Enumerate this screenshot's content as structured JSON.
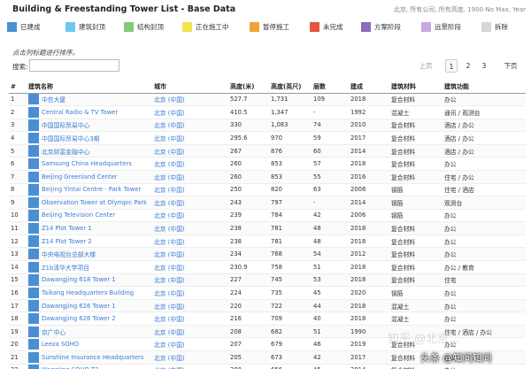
{
  "header": {
    "title": "Building & Freestanding Tower List - Base Data",
    "filters": "北京, 所有公司, 所有高度, 1900-No Max, Year"
  },
  "legend": [
    {
      "label": "已建成",
      "color": "#4a8fd4"
    },
    {
      "label": "建筑封顶",
      "color": "#6ec8f0"
    },
    {
      "label": "结构封顶",
      "color": "#86c97a"
    },
    {
      "label": "正在施工中",
      "color": "#f2e34f"
    },
    {
      "label": "暂停施工",
      "color": "#f2a23a"
    },
    {
      "label": "未完成",
      "color": "#e0573c"
    },
    {
      "label": "方案阶段",
      "color": "#8a6bbf"
    },
    {
      "label": "远景阶段",
      "color": "#c9a9e0"
    },
    {
      "label": "拆除",
      "color": "#d6d6d6"
    }
  ],
  "toolbar": {
    "sort_hint": "点击列标题进行排序。",
    "search_label": "搜索:",
    "search_value": "",
    "search_placeholder": ""
  },
  "pagination": {
    "prev_label": "上页",
    "pages": [
      "1",
      "2",
      "3"
    ],
    "current_page": "1",
    "next_label": "下页"
  },
  "table": {
    "columns": [
      "#",
      "建筑名称",
      "城市",
      "高度(米)",
      "高度(英尺)",
      "层数",
      "建成",
      "建筑材料",
      "建筑功能"
    ],
    "rows": [
      {
        "num": "1",
        "name": "中信大厦",
        "city": "北京 (中国)",
        "height_m": "527.7",
        "height_ft": "1,731",
        "floors": "109",
        "year": "2018",
        "material": "复合材料",
        "function": "办公"
      },
      {
        "num": "2",
        "name": "Central Radio & TV Tower",
        "city": "北京 (中国)",
        "height_m": "410.5",
        "height_ft": "1,347",
        "floors": "-",
        "year": "1992",
        "material": "混凝土",
        "function": "通讯 / 观测台"
      },
      {
        "num": "3",
        "name": "中国国际贸易中心",
        "city": "北京 (中国)",
        "height_m": "330",
        "height_ft": "1,083",
        "floors": "74",
        "year": "2010",
        "material": "复合材料",
        "function": "酒店 / 办公"
      },
      {
        "num": "4",
        "name": "中国国际贸易中心3期",
        "city": "北京 (中国)",
        "height_m": "295.6",
        "height_ft": "970",
        "floors": "59",
        "year": "2017",
        "material": "复合材料",
        "function": "酒店 / 办公"
      },
      {
        "num": "5",
        "name": "北京财富金融中心",
        "city": "北京 (中国)",
        "height_m": "267",
        "height_ft": "876",
        "floors": "60",
        "year": "2014",
        "material": "复合材料",
        "function": "酒店 / 办公"
      },
      {
        "num": "6",
        "name": "Samsung China Headquarters",
        "city": "北京 (中国)",
        "height_m": "260",
        "height_ft": "853",
        "floors": "57",
        "year": "2018",
        "material": "复合材料",
        "function": "办公"
      },
      {
        "num": "7",
        "name": "Beijing Greenland Center",
        "city": "北京 (中国)",
        "height_m": "260",
        "height_ft": "853",
        "floors": "55",
        "year": "2016",
        "material": "复合材料",
        "function": "住宅 / 办公"
      },
      {
        "num": "8",
        "name": "Beijing Yintai Centre - Park Tower",
        "city": "北京 (中国)",
        "height_m": "250",
        "height_ft": "820",
        "floors": "63",
        "year": "2008",
        "material": "钢筋",
        "function": "住宅 / 酒店"
      },
      {
        "num": "9",
        "name": "Observation Tower at Olympic Park",
        "city": "北京 (中国)",
        "height_m": "243",
        "height_ft": "797",
        "floors": "-",
        "year": "2014",
        "material": "钢筋",
        "function": "观测台"
      },
      {
        "num": "10",
        "name": "Beijing Television Center",
        "city": "北京 (中国)",
        "height_m": "239",
        "height_ft": "784",
        "floors": "42",
        "year": "2006",
        "material": "钢筋",
        "function": "办公"
      },
      {
        "num": "11",
        "name": "Z14 Plot Tower 1",
        "city": "北京 (中国)",
        "height_m": "238",
        "height_ft": "781",
        "floors": "48",
        "year": "2018",
        "material": "复合材料",
        "function": "办公"
      },
      {
        "num": "12",
        "name": "Z14 Plot Tower 2",
        "city": "北京 (中国)",
        "height_m": "238",
        "height_ft": "781",
        "floors": "48",
        "year": "2018",
        "material": "复合材料",
        "function": "办公"
      },
      {
        "num": "13",
        "name": "中央电视台总部大楼",
        "city": "北京 (中国)",
        "height_m": "234",
        "height_ft": "768",
        "floors": "54",
        "year": "2012",
        "material": "复合材料",
        "function": "办公"
      },
      {
        "num": "14",
        "name": "Z1b清华大学项目",
        "city": "北京 (中国)",
        "height_m": "230.9",
        "height_ft": "758",
        "floors": "51",
        "year": "2018",
        "material": "复合材料",
        "function": "办公 / 教育"
      },
      {
        "num": "15",
        "name": "Dawangjing 618 Tower 1",
        "city": "北京 (中国)",
        "height_m": "227",
        "height_ft": "745",
        "floors": "53",
        "year": "2018",
        "material": "复合材料",
        "function": "住宅"
      },
      {
        "num": "16",
        "name": "Taikang Headquarters Building",
        "city": "北京 (中国)",
        "height_m": "224",
        "height_ft": "735",
        "floors": "45",
        "year": "2020",
        "material": "钢筋",
        "function": "办公"
      },
      {
        "num": "17",
        "name": "Dawangjing 626 Tower 1",
        "city": "北京 (中国)",
        "height_m": "220",
        "height_ft": "722",
        "floors": "44",
        "year": "2018",
        "material": "混凝土",
        "function": "办公"
      },
      {
        "num": "18",
        "name": "Dawangjing 626 Tower 2",
        "city": "北京 (中国)",
        "height_m": "216",
        "height_ft": "709",
        "floors": "40",
        "year": "2018",
        "material": "混凝土",
        "function": "办公"
      },
      {
        "num": "19",
        "name": "京广中心",
        "city": "北京 (中国)",
        "height_m": "208",
        "height_ft": "682",
        "floors": "51",
        "year": "1990",
        "material": "",
        "function": "住宅 / 酒店 / 办公"
      },
      {
        "num": "20",
        "name": "Leeza SOHO",
        "city": "北京 (中国)",
        "height_m": "207",
        "height_ft": "679",
        "floors": "46",
        "year": "2019",
        "material": "复合材料",
        "function": "办公"
      },
      {
        "num": "21",
        "name": "Sunshine Insurance Headquarters",
        "city": "北京 (中国)",
        "height_m": "205",
        "height_ft": "673",
        "floors": "42",
        "year": "2017",
        "material": "复合材料",
        "function": "办公"
      },
      {
        "num": "22",
        "name": "Wangjing SOHO T3",
        "city": "北京 (中国)",
        "height_m": "200",
        "height_ft": "656",
        "floors": "45",
        "year": "2014",
        "material": "复合材料",
        "function": "办公"
      }
    ],
    "row_status_color": "#4a8fd4"
  },
  "watermark": "知乎 @北京...",
  "credit": "头条 @知问知问"
}
